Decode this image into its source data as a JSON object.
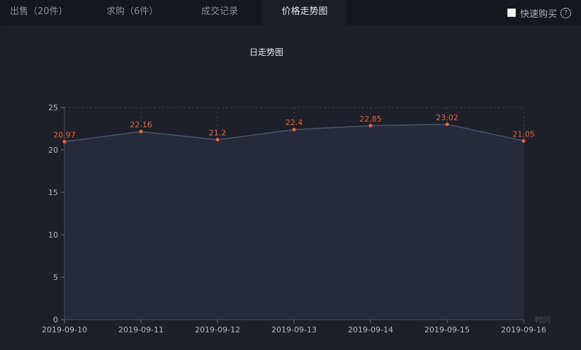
{
  "tabs": [
    {
      "label": "出售（20件）",
      "active": false
    },
    {
      "label": "求购（6件）",
      "active": false
    },
    {
      "label": "成交记录",
      "active": false
    },
    {
      "label": "价格走势图",
      "active": true
    }
  ],
  "quick_buy": {
    "label": "快速购买",
    "checked": false,
    "help_icon": "?"
  },
  "colors": {
    "accent": "#e8663a",
    "line": "#4a5573",
    "area": "#262a3b",
    "grid": "#3a3f4e"
  },
  "chart_data": {
    "type": "area",
    "title": "日走势图",
    "xlabel": "时间",
    "ylabel": "",
    "x": [
      "2019-09-10",
      "2019-09-11",
      "2019-09-12",
      "2019-09-13",
      "2019-09-14",
      "2019-09-15",
      "2019-09-16"
    ],
    "values": [
      20.97,
      22.16,
      21.2,
      22.4,
      22.85,
      23.02,
      21.05
    ],
    "data_labels": [
      "20.97",
      "22.16",
      "21.2",
      "22.4",
      "22.85",
      "23.02",
      "21.05"
    ],
    "yticks": [
      0,
      5,
      10,
      15,
      20,
      25
    ],
    "ylim": [
      0,
      25
    ],
    "grid": true,
    "legend": "none"
  }
}
